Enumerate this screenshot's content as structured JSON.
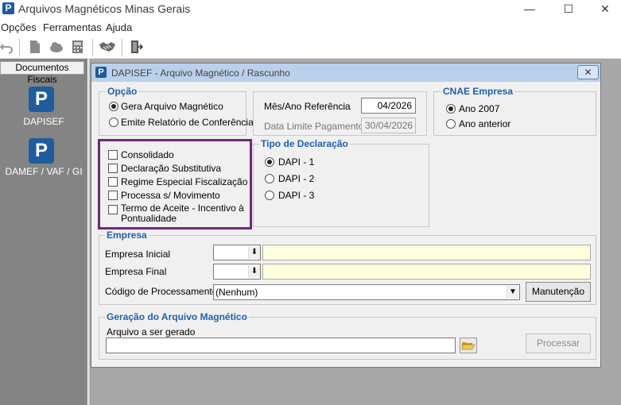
{
  "window": {
    "title": "Arquivos Magnéticos Minas Gerais",
    "minimize": "—",
    "maximize": "☐",
    "close": "✕",
    "app_icon": "P"
  },
  "menu": {
    "items": [
      "Opções",
      "Ferramentas",
      "Ajuda"
    ]
  },
  "toolbar": {
    "icons": [
      "undo-icon",
      "document-icon",
      "cloud-icon",
      "calculator-icon",
      "handshake-icon",
      "exit-door-icon"
    ]
  },
  "left_panel": {
    "tab": "Documentos Fiscais",
    "items": [
      {
        "label": "DAPISEF",
        "icon": "P"
      },
      {
        "label": "DAMEF / VAF / GI",
        "icon": "P"
      }
    ]
  },
  "dialog": {
    "title": "DAPISEF - Arquivo Magnético / Rascunho",
    "close": "✕",
    "opcao": {
      "title": "Opção",
      "options": [
        "Gera Arquivo Magnético",
        "Emite Relatório de Conferência"
      ],
      "selected": 0
    },
    "referencia": {
      "mes_ano_label": "Mês/Ano Referência",
      "mes_ano_value": "04/2026",
      "data_limite_label": "Data Limite Pagamento",
      "data_limite_value": "30/04/2026"
    },
    "cnae": {
      "title": "CNAE Empresa",
      "options": [
        "Ano 2007",
        "Ano anterior"
      ],
      "selected": 0
    },
    "checks": [
      "Consolidado",
      "Declaração Substitutiva",
      "Regime Especial Fiscalização",
      "Processa s/ Movimento",
      "Termo de Aceite - Incentivo à",
      "Pontualidade"
    ],
    "tipo": {
      "title": "Tipo de Declaração",
      "options": [
        "DAPI - 1",
        "DAPI - 2",
        "DAPI - 3"
      ],
      "selected": 0
    },
    "empresa": {
      "title": "Empresa",
      "inicial_label": "Empresa Inicial",
      "final_label": "Empresa Final",
      "codigo_label": "Código de Processamento",
      "codigo_value": "(Nenhum)",
      "manutencao": "Manutenção"
    },
    "geracao": {
      "title": "Geração do Arquivo Magnético",
      "arquivo_label": "Arquivo a ser gerado",
      "processar": "Processar"
    }
  },
  "colors": {
    "accent": "#2060b0",
    "highlight": "#72267f",
    "input_yellow": "#ffffdd"
  }
}
